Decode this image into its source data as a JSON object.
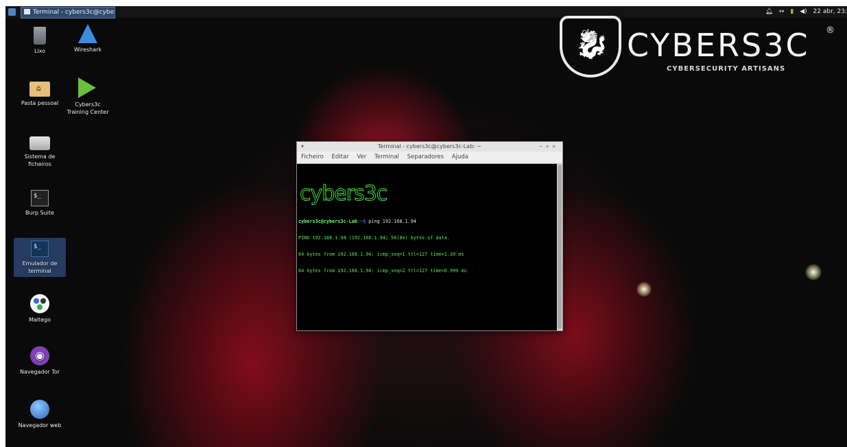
{
  "panel": {
    "task_title": "Terminal - cybers3c@cybers...",
    "tray_icons": [
      "bell-icon",
      "network-icon",
      "battery-icon",
      "volume-icon"
    ],
    "clock": "22 abr, 23:"
  },
  "desktop": {
    "icons": [
      {
        "label": "Lixo",
        "icon": "trash-icon"
      },
      {
        "label": "Wireshark",
        "icon": "wireshark-icon"
      },
      {
        "label": "Pasta pessoal",
        "icon": "home-folder-icon"
      },
      {
        "label": "Cybers3c\nTraining Center",
        "icon": "training-center-icon"
      },
      {
        "label": "Sistema de\nficheiros",
        "icon": "drive-icon"
      },
      {
        "label": "Burp Suite",
        "icon": "burp-terminal-icon"
      },
      {
        "label": "Emulador de\nterminal",
        "icon": "terminal-icon"
      },
      {
        "label": "Maltego",
        "icon": "maltego-icon"
      },
      {
        "label": "Navegador Tor",
        "icon": "tor-icon"
      },
      {
        "label": "Navegador web",
        "icon": "globe-icon"
      }
    ]
  },
  "wallpaper": {
    "logo_text": "CYBERS3C",
    "logo_reg": "®",
    "tagline": "CYBERSECURITY ARTISANS"
  },
  "terminal": {
    "title": "Terminal - cybers3c@cybers3c-Lab: ~",
    "menu": [
      "Ficheiro",
      "Editar",
      "Ver",
      "Terminal",
      "Separadores",
      "Ajuda"
    ],
    "banner": "cybers3c",
    "prompt_user": "cybers3c@cybers3c-Lab",
    "prompt_path": ":~$",
    "command": " ping 192.168.1.94",
    "output": [
      "PING 192.168.1.94 (192.168.1.94) 56(84) bytes of data.",
      "64 bytes from 192.168.1.94: icmp_seq=1 ttl=127 time=1.39 ms",
      "64 bytes from 192.168.1.94: icmp_seq=2 ttl=127 time=0.999 ms"
    ]
  },
  "colors": {
    "terminal_text": "#4ef04e",
    "panel_bg": "#141414",
    "accent": "#2e4a6d"
  }
}
